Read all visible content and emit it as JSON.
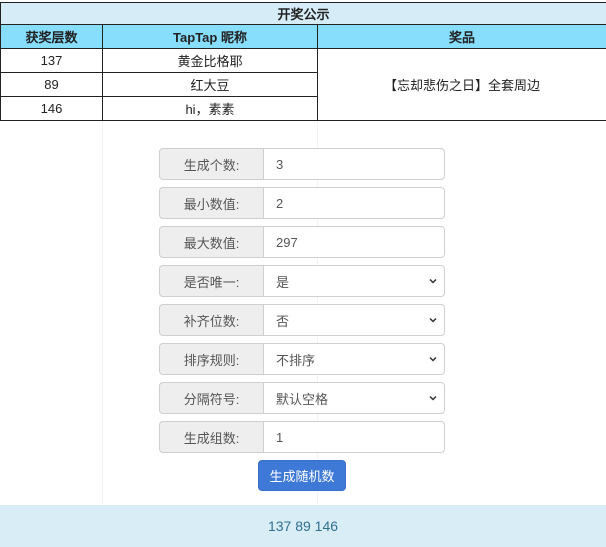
{
  "table": {
    "title": "开奖公示",
    "headers": [
      "获奖层数",
      "TapTap 昵称",
      "奖品"
    ],
    "rows": [
      {
        "floor": "137",
        "nickname": "黄金比格耶"
      },
      {
        "floor": "89",
        "nickname": "红大豆"
      },
      {
        "floor": "146",
        "nickname": "hi，素素"
      }
    ],
    "prize": "【忘却悲伤之日】全套周边"
  },
  "form": {
    "count": {
      "label": "生成个数:",
      "value": "3"
    },
    "min": {
      "label": "最小数值:",
      "value": "2"
    },
    "max": {
      "label": "最大数值:",
      "value": "297"
    },
    "unique": {
      "label": "是否唯一:",
      "value": "是"
    },
    "pad": {
      "label": "补齐位数:",
      "value": "否"
    },
    "sort": {
      "label": "排序规则:",
      "value": "不排序"
    },
    "separator": {
      "label": "分隔符号:",
      "value": "默认空格"
    },
    "groups": {
      "label": "生成组数:",
      "value": "1"
    },
    "generate_label": "生成随机数"
  },
  "output": "137 89 146",
  "colors": {
    "title_bg": "#d6ecf6",
    "header_bg": "#86ddfc",
    "button_bg": "#3f79d8",
    "output_bg": "#d9edf7",
    "output_text": "#31708f"
  }
}
